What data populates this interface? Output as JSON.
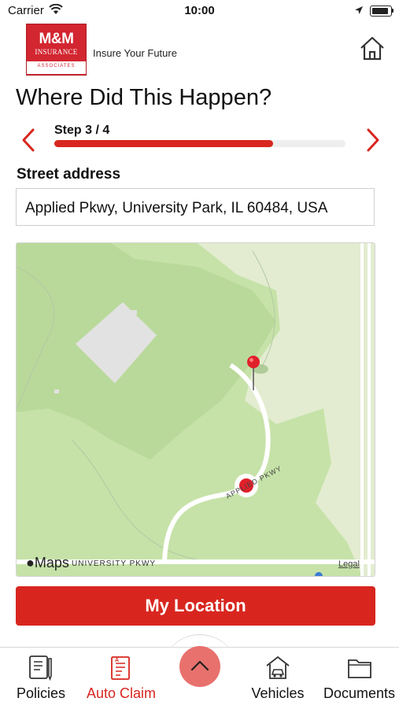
{
  "status_bar": {
    "carrier": "Carrier",
    "time": "10:00"
  },
  "header": {
    "logo_main": "M&M",
    "logo_sub": "INSURANCE",
    "logo_band": "ASSOCIATES",
    "tagline": "Insure Your Future"
  },
  "page": {
    "title": "Where Did This Happen?"
  },
  "step": {
    "label": "Step 3 / 4",
    "progress": 0.75
  },
  "address": {
    "label": "Street address",
    "value": "Applied Pkwy, University Park, IL 60484, USA"
  },
  "map": {
    "brand": "Maps",
    "legal": "Legal",
    "road_label_1": "UNIVERSITY PKWY",
    "road_label_2": "APPLIED PKWY",
    "pin_color": "#e0202a"
  },
  "actions": {
    "my_location": "My Location"
  },
  "tabs": [
    {
      "label": "Policies",
      "icon": "document-pen-icon",
      "active": false
    },
    {
      "label": "Auto Claim",
      "icon": "claim-form-icon",
      "active": true
    },
    {
      "label": "Vehicles",
      "icon": "car-house-icon",
      "active": false
    },
    {
      "label": "Documents",
      "icon": "folder-icon",
      "active": false
    }
  ],
  "colors": {
    "accent": "#d8261f",
    "active_tab": "#d8261f",
    "center_button": "#e8716d"
  }
}
